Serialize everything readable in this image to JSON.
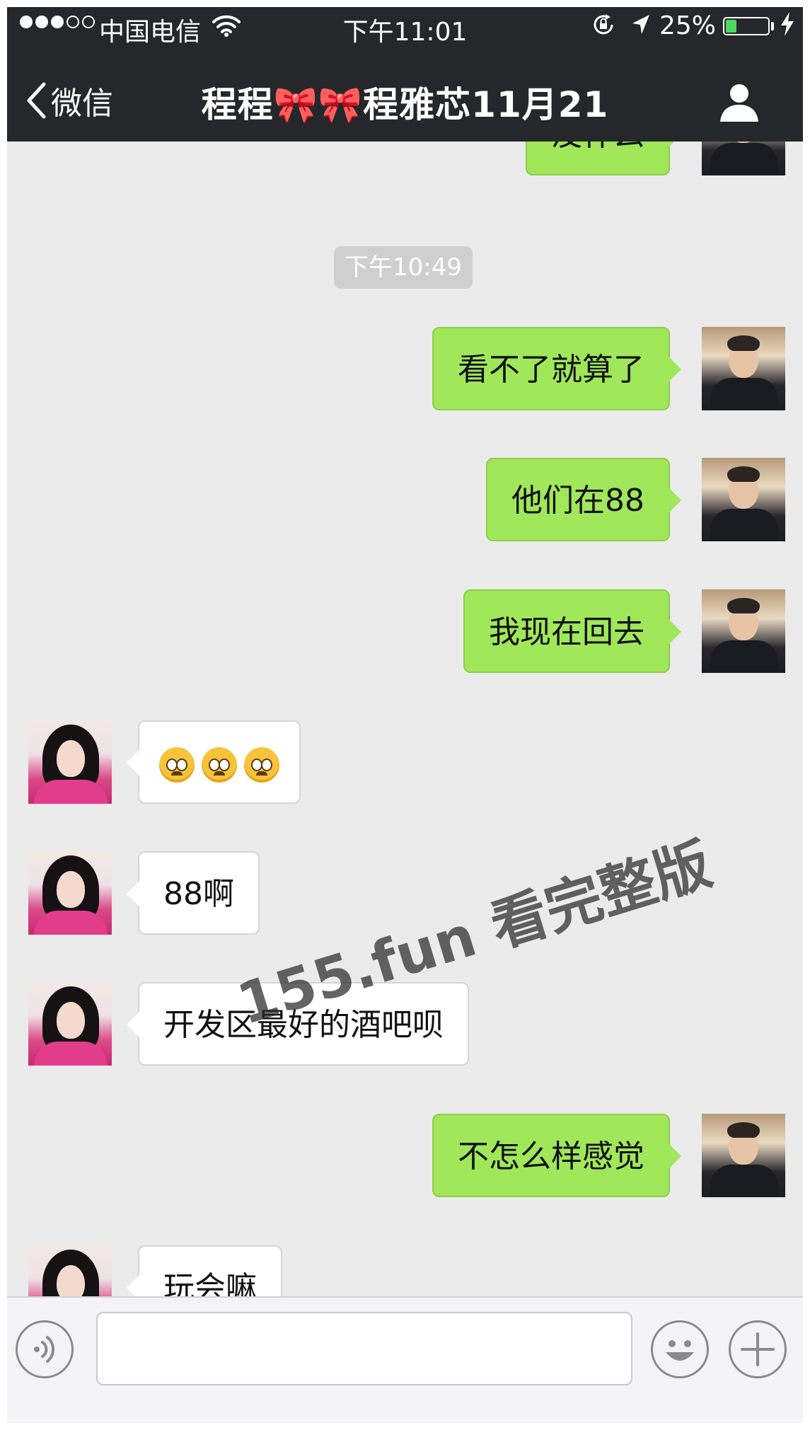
{
  "status_bar": {
    "signal_dots": [
      true,
      true,
      true,
      false,
      false
    ],
    "carrier": "中国电信",
    "time": "下午11:01",
    "battery_text": "25%",
    "battery_level": 0.25,
    "battery_color": "#4cd964"
  },
  "nav": {
    "back_label": "微信",
    "title": "程程🎀🎀程雅芯11月21",
    "profile_icon": "person-icon"
  },
  "chat": {
    "timestamp": "下午10:49",
    "messages": [
      {
        "side": "out",
        "text": "没什么"
      },
      {
        "side": "out",
        "text": "看不了就算了"
      },
      {
        "side": "out",
        "text": "他们在88"
      },
      {
        "side": "out",
        "text": "我现在回去"
      },
      {
        "side": "in",
        "text": "",
        "emoji_count": 3,
        "emoji": "pleading-face-icon"
      },
      {
        "side": "in",
        "text": "88啊"
      },
      {
        "side": "in",
        "text": "开发区最好的酒吧呗"
      },
      {
        "side": "out",
        "text": "不怎么样感觉"
      },
      {
        "side": "in",
        "text": "玩会嘛"
      }
    ]
  },
  "watermark": "155.fun 看完整版",
  "input_bar": {
    "voice_icon": "voice-icon",
    "text_value": "",
    "emoji_icon": "smiley-icon",
    "plus_icon": "plus-icon"
  },
  "colors": {
    "outgoing_bubble": "#a0e75a",
    "incoming_bubble": "#ffffff",
    "nav_bg": "#26272b",
    "chat_bg": "#ebebeb"
  }
}
